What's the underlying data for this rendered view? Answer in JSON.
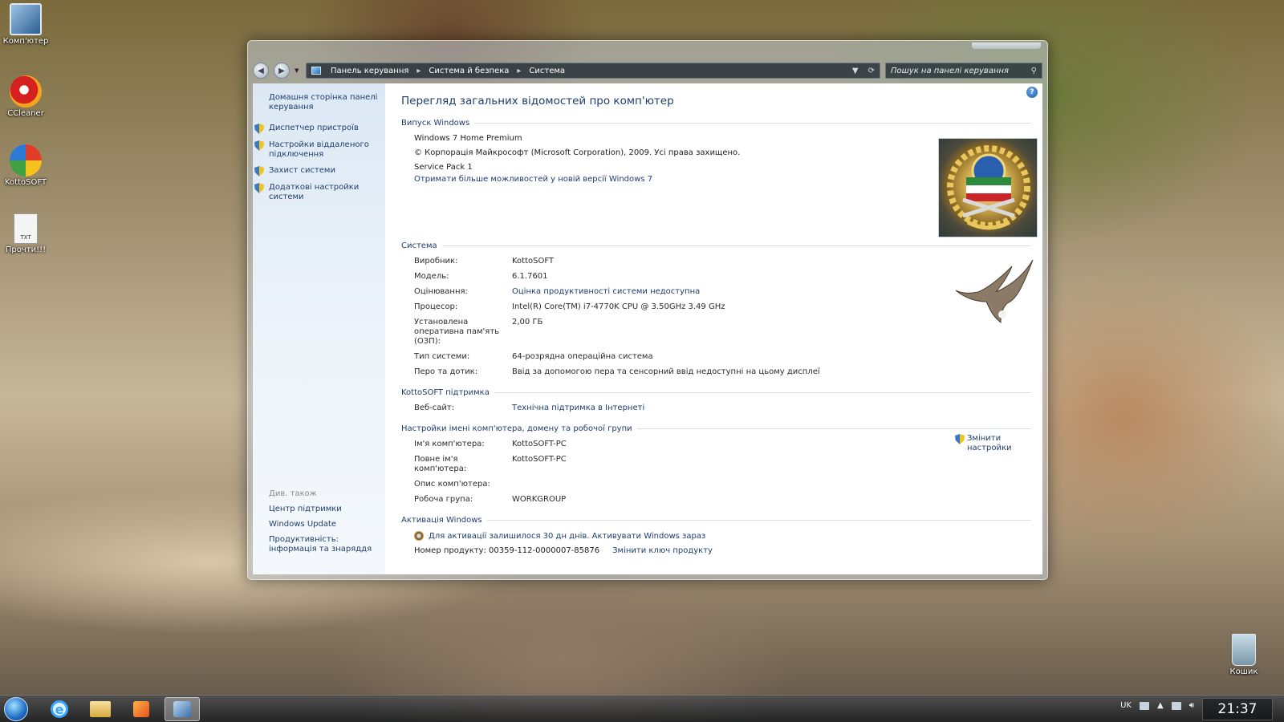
{
  "desktop": {
    "icons": [
      {
        "label": "Комп'ютер"
      },
      {
        "label": "CCleaner"
      },
      {
        "label": "KottoSOFT"
      },
      {
        "label": "Прочти!!!",
        "badge": "TXT"
      },
      {
        "label": "Кошик"
      }
    ]
  },
  "window": {
    "breadcrumb": [
      "Панель керування",
      "Система й безпека",
      "Система"
    ],
    "search_placeholder": "Пошук на панелі керування",
    "sidebar": {
      "home_link": "Домашня сторінка панелі керування",
      "links": [
        "Диспетчер пристроїв",
        "Настройки віддаленого підключення",
        "Захист системи",
        "Додаткові настройки системи"
      ],
      "see_also_title": "Див. також",
      "see_also_links": [
        "Центр підтримки",
        "Windows Update",
        "Продуктивність: інформація та знаряддя"
      ]
    },
    "main": {
      "title": "Перегляд загальних відомостей про комп'ютер",
      "edition": {
        "heading": "Випуск Windows",
        "name": "Windows 7 Home Premium",
        "copyright": "© Корпорація Майкрософт (Microsoft Corporation), 2009. Усі права захищено.",
        "service_pack": "Service Pack 1",
        "upgrade_link": "Отримати більше можливостей у новій версії Windows 7"
      },
      "system": {
        "heading": "Система",
        "rows": [
          {
            "label": "Виробник:",
            "value": "KottoSOFT"
          },
          {
            "label": "Модель:",
            "value": "6.1.7601"
          },
          {
            "label": "Оцінювання:",
            "value": "Оцінка продуктивності системи недоступна"
          },
          {
            "label": "Процесор:",
            "value": "Intel(R) Core(TM) i7-4770K CPU @ 3.50GHz   3.49 GHz"
          },
          {
            "label": "Установлена оперативна пам'ять (ОЗП):",
            "value": "2,00 ГБ"
          },
          {
            "label": "Тип системи:",
            "value": "64-розрядна операційна система"
          },
          {
            "label": "Перо та дотик:",
            "value": "Ввід за допомогою пера та сенсорний ввід недоступні на цьому дисплеї"
          }
        ]
      },
      "support": {
        "heading": "KottoSOFT підтримка",
        "rows": [
          {
            "label": "Веб-сайт:",
            "value": "Технічна підтримка в Інтернеті"
          }
        ]
      },
      "computer_name": {
        "heading": "Настройки імені комп'ютера, домену та робочої групи",
        "change_link": "Змінити настройки",
        "rows": [
          {
            "label": "Ім'я комп'ютера:",
            "value": "KottoSOFT-PC"
          },
          {
            "label": "Повне ім'я комп'ютера:",
            "value": "KottoSOFT-PC"
          },
          {
            "label": "Опис комп'ютера:",
            "value": ""
          },
          {
            "label": "Робоча група:",
            "value": "WORKGROUP"
          }
        ]
      },
      "activation": {
        "heading": "Активація Windows",
        "status": "Для активації залишилося 30 дн днів. Активувати Windows зараз",
        "product_id": "Номер продукту: 00359-112-0000007-85876",
        "change_key_link": "Змінити ключ продукту"
      }
    }
  },
  "taskbar": {
    "language": "UK",
    "time": "21:37"
  }
}
